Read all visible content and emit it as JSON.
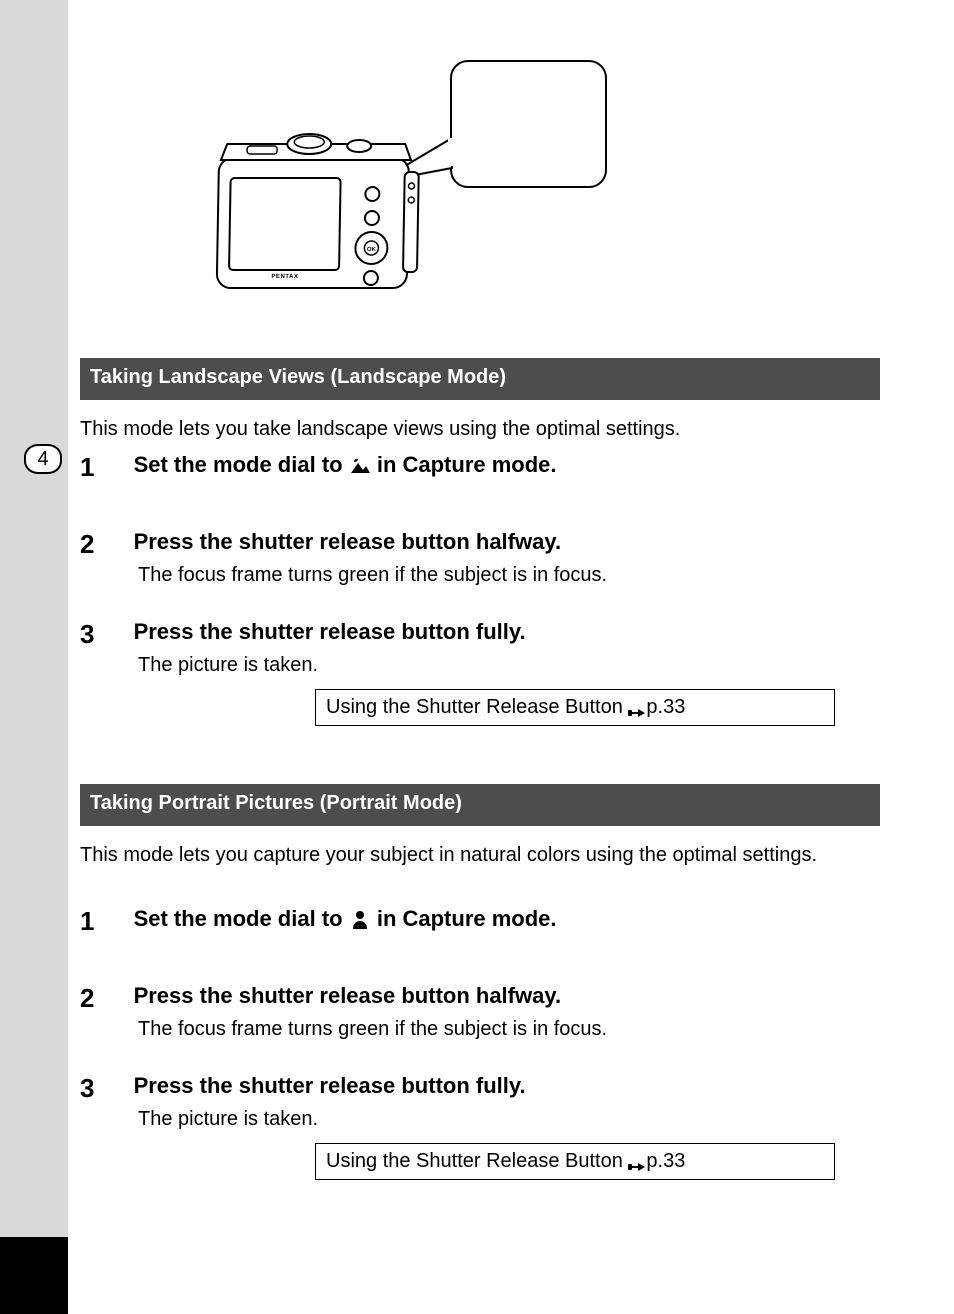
{
  "tab_number": "4",
  "camera_brand_label": "PENTAX",
  "sections": [
    {
      "title": "Taking Landscape Views (Landscape Mode)",
      "intro": "This mode lets you take landscape views using the optimal settings.",
      "mode_icon_name": "landscape",
      "steps": [
        {
          "num": "1",
          "title_before": "Set the mode dial to ",
          "title_after": " in Capture mode.",
          "desc": ""
        },
        {
          "num": "2",
          "title_before": "Press the shutter release button halfway.",
          "title_after": "",
          "desc": "The focus frame turns green if the subject is in focus."
        },
        {
          "num": "3",
          "title_before": "Press the shutter release button fully.",
          "title_after": "",
          "desc": "The picture is taken."
        }
      ],
      "ref_text": "Using the Shutter Release Button",
      "ref_page": "p.33"
    },
    {
      "title": "Taking Portrait Pictures (Portrait Mode)",
      "intro": "This mode lets you capture your subject in natural colors using the optimal settings.",
      "mode_icon_name": "portrait",
      "steps": [
        {
          "num": "1",
          "title_before": "Set the mode dial to ",
          "title_after": " in Capture mode.",
          "desc": ""
        },
        {
          "num": "2",
          "title_before": "Press the shutter release button halfway.",
          "title_after": "",
          "desc": "The focus frame turns green if the subject is in focus."
        },
        {
          "num": "3",
          "title_before": "Press the shutter release button fully.",
          "title_after": "",
          "desc": "The picture is taken."
        }
      ],
      "ref_text": "Using the Shutter Release Button",
      "ref_page": "p.33"
    }
  ]
}
